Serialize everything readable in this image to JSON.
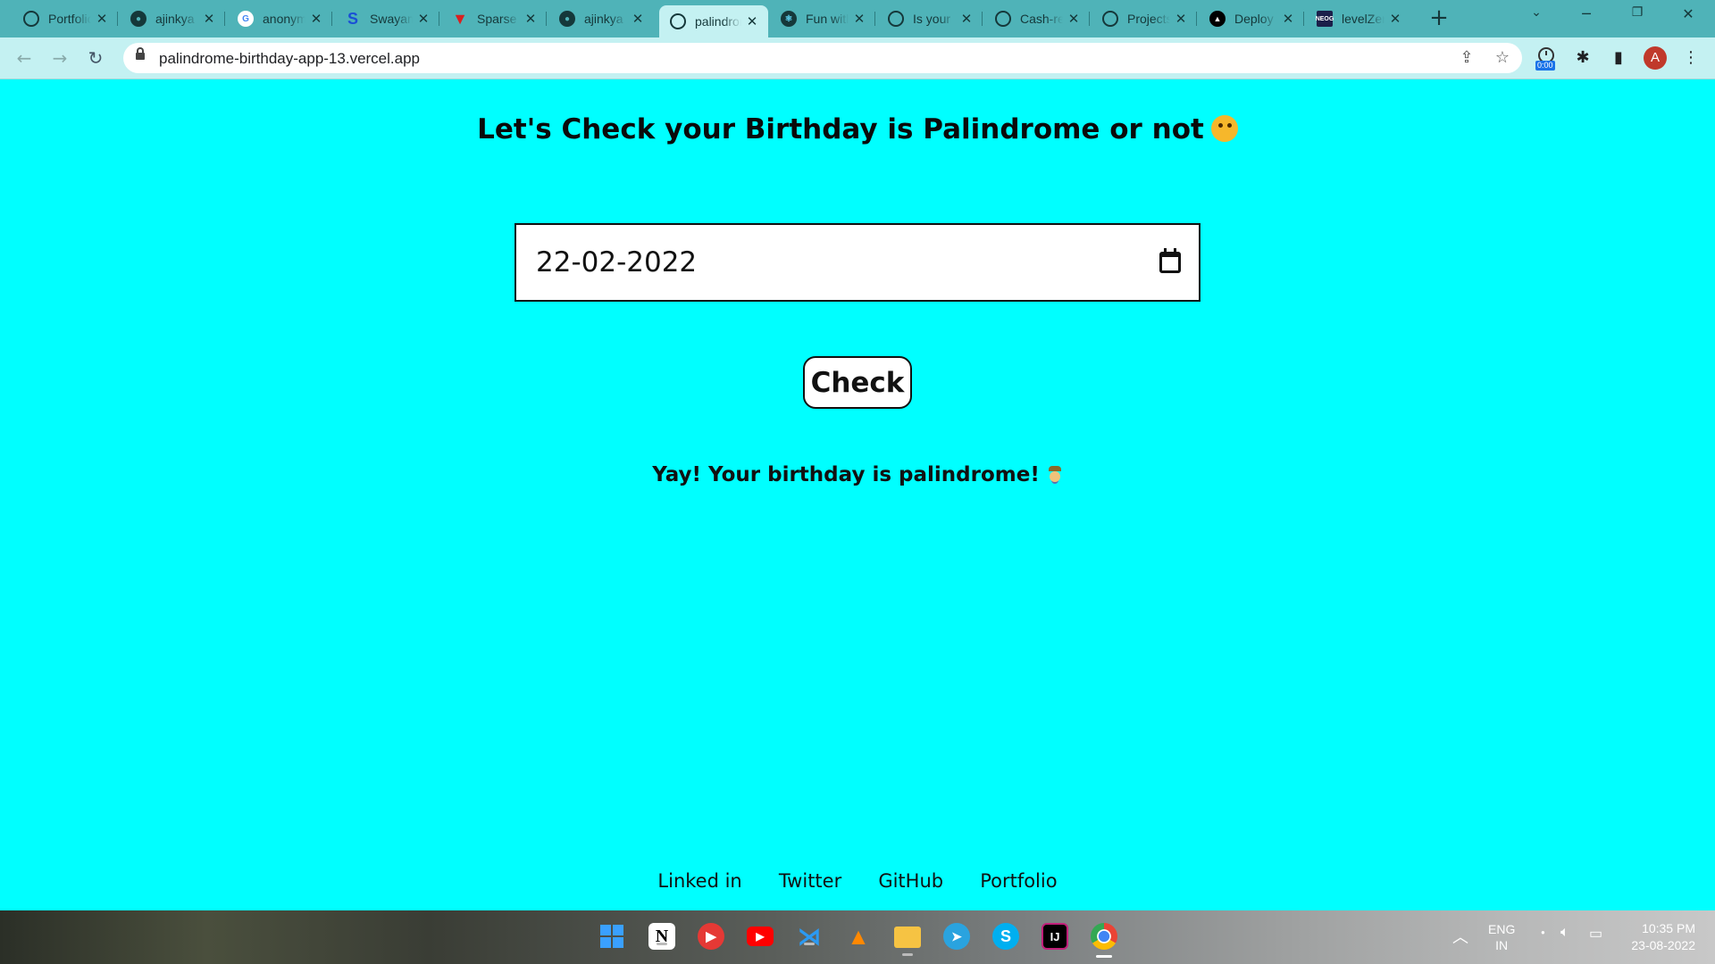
{
  "browser": {
    "tabs": [
      {
        "label": "Portfolio",
        "icon": "globe-icon"
      },
      {
        "label": "ajinkya",
        "icon": "github-icon"
      },
      {
        "label": "anonymous",
        "icon": "google-icon"
      },
      {
        "label": "Swayam",
        "icon": "swayam-icon"
      },
      {
        "label": "Sparse",
        "icon": "sparse-icon"
      },
      {
        "label": "ajinkya",
        "icon": "github-icon"
      },
      {
        "label": "palindrome",
        "icon": "globe-icon",
        "active": true
      },
      {
        "label": "Fun with",
        "icon": "react-icon"
      },
      {
        "label": "Is your",
        "icon": "globe-icon"
      },
      {
        "label": "Cash-register",
        "icon": "globe-icon"
      },
      {
        "label": "Projects",
        "icon": "globe-icon"
      },
      {
        "label": "Deploy",
        "icon": "vercel-icon"
      },
      {
        "label": "levelZero",
        "icon": "neog-icon"
      }
    ],
    "url": "palindrome-birthday-app-13.vercel.app",
    "timer_badge": "0:00",
    "profile_initial": "A",
    "accent_color": "#4fb3b8"
  },
  "page": {
    "background": "#00ffff",
    "heading": "Let's Check your Birthday is Palindrome or not",
    "date_value": "22-02-2022",
    "check_label": "Check",
    "result_text": "Yay! Your birthday is palindrome!",
    "footer_links": [
      "Linked in",
      "Twitter",
      "GitHub",
      "Portfolio"
    ]
  },
  "taskbar": {
    "apps": [
      "windows-start-icon",
      "notion-icon",
      "youtube-music-icon",
      "youtube-icon",
      "vscode-icon",
      "vlc-icon",
      "file-explorer-icon",
      "telegram-icon",
      "skype-icon",
      "intellij-icon",
      "chrome-icon"
    ],
    "lang_primary": "ENG",
    "lang_secondary": "IN",
    "time": "10:35 PM",
    "date": "23-08-2022"
  }
}
